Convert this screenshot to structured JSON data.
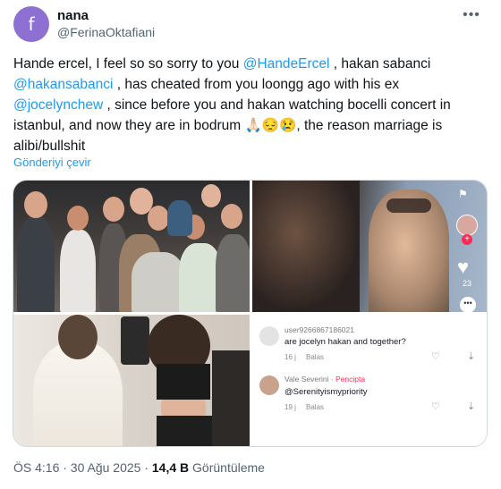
{
  "author": {
    "avatar_letter": "f",
    "name": "nana",
    "handle": "@FerinaOktafiani"
  },
  "tweet": {
    "segments": [
      {
        "text": "Hande ercel, I feel so so sorry to you ",
        "mention": false
      },
      {
        "text": "@HandeErcel",
        "mention": true
      },
      {
        "text": " , hakan sabanci ",
        "mention": false
      },
      {
        "text": "@hakansabanci",
        "mention": true
      },
      {
        "text": " , has cheated from you loongg ago with his ex ",
        "mention": false
      },
      {
        "text": "@jocelynchew",
        "mention": true
      },
      {
        "text": " , since before you and hakan watching bocelli concert in istanbul, and now they are in bodrum 🙏🏻😔😢, the reason marriage is alibi/bullshit",
        "mention": false
      }
    ],
    "translate_label": "Gönderiyi çevir"
  },
  "media": {
    "tiktok_likes": "23",
    "comments": [
      {
        "user": "user9266867186021",
        "creator_tag": "",
        "text": "are jocelyn hakan and together?",
        "time": "16 j",
        "reply": "Balas"
      },
      {
        "user": "Vale Severini",
        "creator_tag": "Pencipta",
        "text": "@Serenityismypriority",
        "time": "19 j",
        "reply": "Balas"
      }
    ]
  },
  "footer": {
    "time": "ÖS 4:16 · 30 Ağu 2025 · ",
    "views_count": "14,4 B",
    "views_label": " Görüntüleme"
  },
  "colors": {
    "accent": "#1d9bf0",
    "avatar_bg": "#8e6fd2",
    "secondary_text": "#536471",
    "creator_tag": "#fe2c55"
  }
}
